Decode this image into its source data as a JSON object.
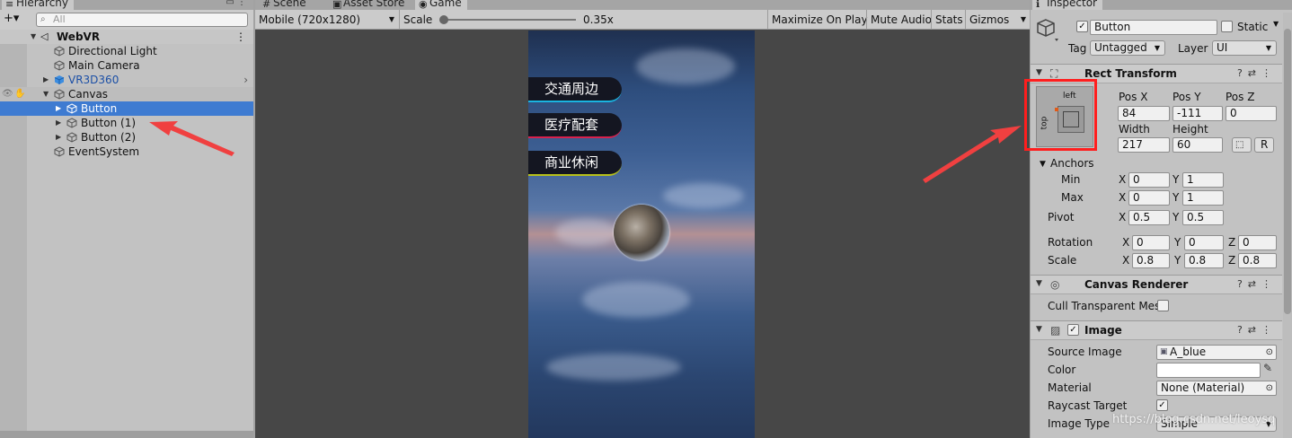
{
  "hierarchy": {
    "tab_label": "Hierarchy",
    "add_label": "+▾",
    "search_placeholder": "All",
    "scene_name": "WebVR",
    "items": [
      {
        "label": "Directional Light"
      },
      {
        "label": "Main Camera"
      },
      {
        "label": "VR3D360"
      },
      {
        "label": "Canvas"
      },
      {
        "label": "Button"
      },
      {
        "label": "Button (1)"
      },
      {
        "label": "Button (2)"
      },
      {
        "label": "EventSystem"
      }
    ]
  },
  "game": {
    "tabs": [
      {
        "label": "Scene"
      },
      {
        "label": "Asset Store"
      },
      {
        "label": "Game"
      }
    ],
    "resolution": "Mobile (720x1280)",
    "scale_label": "Scale",
    "scale_value": "0.35x",
    "toolbar_buttons": [
      "Maximize On Play",
      "Mute Audio",
      "Stats",
      "Gizmos"
    ],
    "buttons": [
      {
        "label": "交通周边",
        "color": "#1ab4e0"
      },
      {
        "label": "医疗配套",
        "color": "#d8214d"
      },
      {
        "label": "商业休闲",
        "color": "#b7c11a"
      }
    ]
  },
  "inspector": {
    "tab_label": "Inspector",
    "object_name": "Button",
    "static_label": "Static",
    "tag_label": "Tag",
    "tag_value": "Untagged",
    "layer_label": "Layer",
    "layer_value": "UI",
    "rect_transform": {
      "title": "Rect Transform",
      "anchor_h": "left",
      "anchor_v": "top",
      "pos_x_label": "Pos X",
      "pos_x": "84",
      "pos_y_label": "Pos Y",
      "pos_y": "-111",
      "pos_z_label": "Pos Z",
      "pos_z": "0",
      "width_label": "Width",
      "width": "217",
      "height_label": "Height",
      "height": "60",
      "r_label": "R",
      "anchors_label": "Anchors",
      "min_label": "Min",
      "min_x": "0",
      "min_y": "1",
      "max_label": "Max",
      "max_x": "0",
      "max_y": "1",
      "pivot_label": "Pivot",
      "pivot_x": "0.5",
      "pivot_y": "0.5",
      "rotation_label": "Rotation",
      "rot_x": "0",
      "rot_y": "0",
      "rot_z": "0",
      "scale_label": "Scale",
      "scale_x": "0.8",
      "scale_y": "0.8",
      "scale_z": "0.8",
      "x": "X",
      "y": "Y",
      "z": "Z"
    },
    "canvas_renderer": {
      "title": "Canvas Renderer",
      "cull_label": "Cull Transparent Mes"
    },
    "image": {
      "title": "Image",
      "source_label": "Source Image",
      "source_value": "A_blue",
      "color_label": "Color",
      "material_label": "Material",
      "material_value": "None (Material)",
      "raycast_label": "Raycast Target",
      "type_label": "Image Type",
      "type_value": "Simple"
    }
  },
  "watermark": "https://blog.csdn.net/leoysq"
}
